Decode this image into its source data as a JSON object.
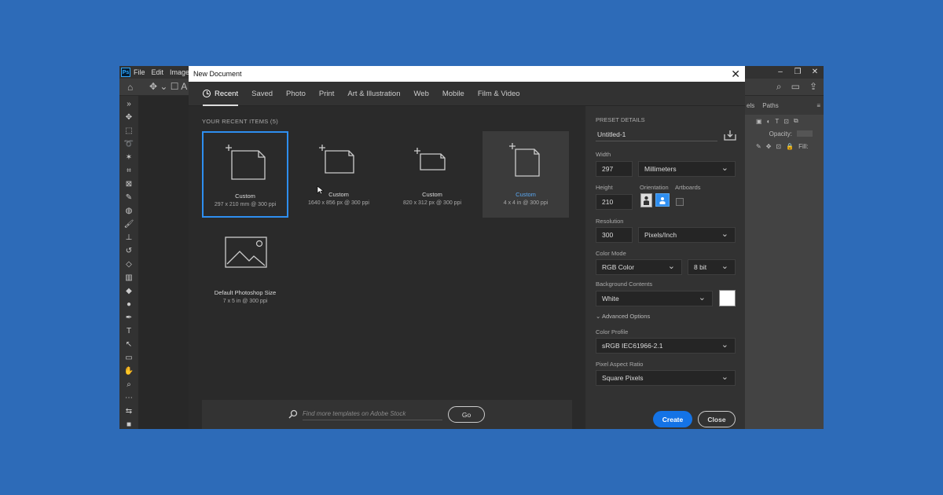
{
  "app": {
    "logo": "Ps",
    "menu": [
      "File",
      "Edit",
      "Image"
    ],
    "window_controls": [
      "–",
      "❐",
      "✕"
    ],
    "options_partial": "A",
    "panel_tabs": [
      "els",
      "Paths"
    ],
    "panel_opacity_label": "Opacity:",
    "panel_fill_label": "Fill:"
  },
  "dialog": {
    "title": "New Document",
    "tabs": [
      {
        "label": "Recent",
        "active": true
      },
      {
        "label": "Saved"
      },
      {
        "label": "Photo"
      },
      {
        "label": "Print"
      },
      {
        "label": "Art & Illustration"
      },
      {
        "label": "Web"
      },
      {
        "label": "Mobile"
      },
      {
        "label": "Film & Video"
      }
    ],
    "recent_heading": "YOUR RECENT ITEMS  (5)",
    "recent_items": [
      {
        "name": "Custom",
        "size": "297 x 210 mm @ 300 ppi",
        "state": "selected"
      },
      {
        "name": "Custom",
        "size": "1640 x 856 px @ 300 ppi"
      },
      {
        "name": "Custom",
        "size": "820 x 312 px @ 300 ppi"
      },
      {
        "name": "Custom",
        "size": "4 x 4 in @ 300 ppi",
        "state": "hovered"
      },
      {
        "name": "Default Photoshop Size",
        "size": "7 x 5 in @ 300 ppi"
      }
    ],
    "stock": {
      "placeholder": "Find more templates on Adobe Stock",
      "go_label": "Go"
    },
    "preset": {
      "heading": "PRESET DETAILS",
      "name": "Untitled-1",
      "width_label": "Width",
      "width_value": "297",
      "width_unit": "Millimeters",
      "height_label": "Height",
      "height_value": "210",
      "orientation_label": "Orientation",
      "artboards_label": "Artboards",
      "resolution_label": "Resolution",
      "resolution_value": "300",
      "resolution_unit": "Pixels/Inch",
      "color_mode_label": "Color Mode",
      "color_mode_value": "RGB Color",
      "bit_depth": "8 bit",
      "background_label": "Background Contents",
      "background_value": "White",
      "advanced_label": "Advanced Options",
      "color_profile_label": "Color Profile",
      "color_profile_value": "sRGB IEC61966-2.1",
      "pixel_aspect_label": "Pixel Aspect Ratio",
      "pixel_aspect_value": "Square Pixels"
    },
    "buttons": {
      "create": "Create",
      "close": "Close"
    }
  },
  "colors": {
    "background": "#2d6bb8",
    "accent": "#1473e6",
    "selection": "#2e8ef0"
  }
}
